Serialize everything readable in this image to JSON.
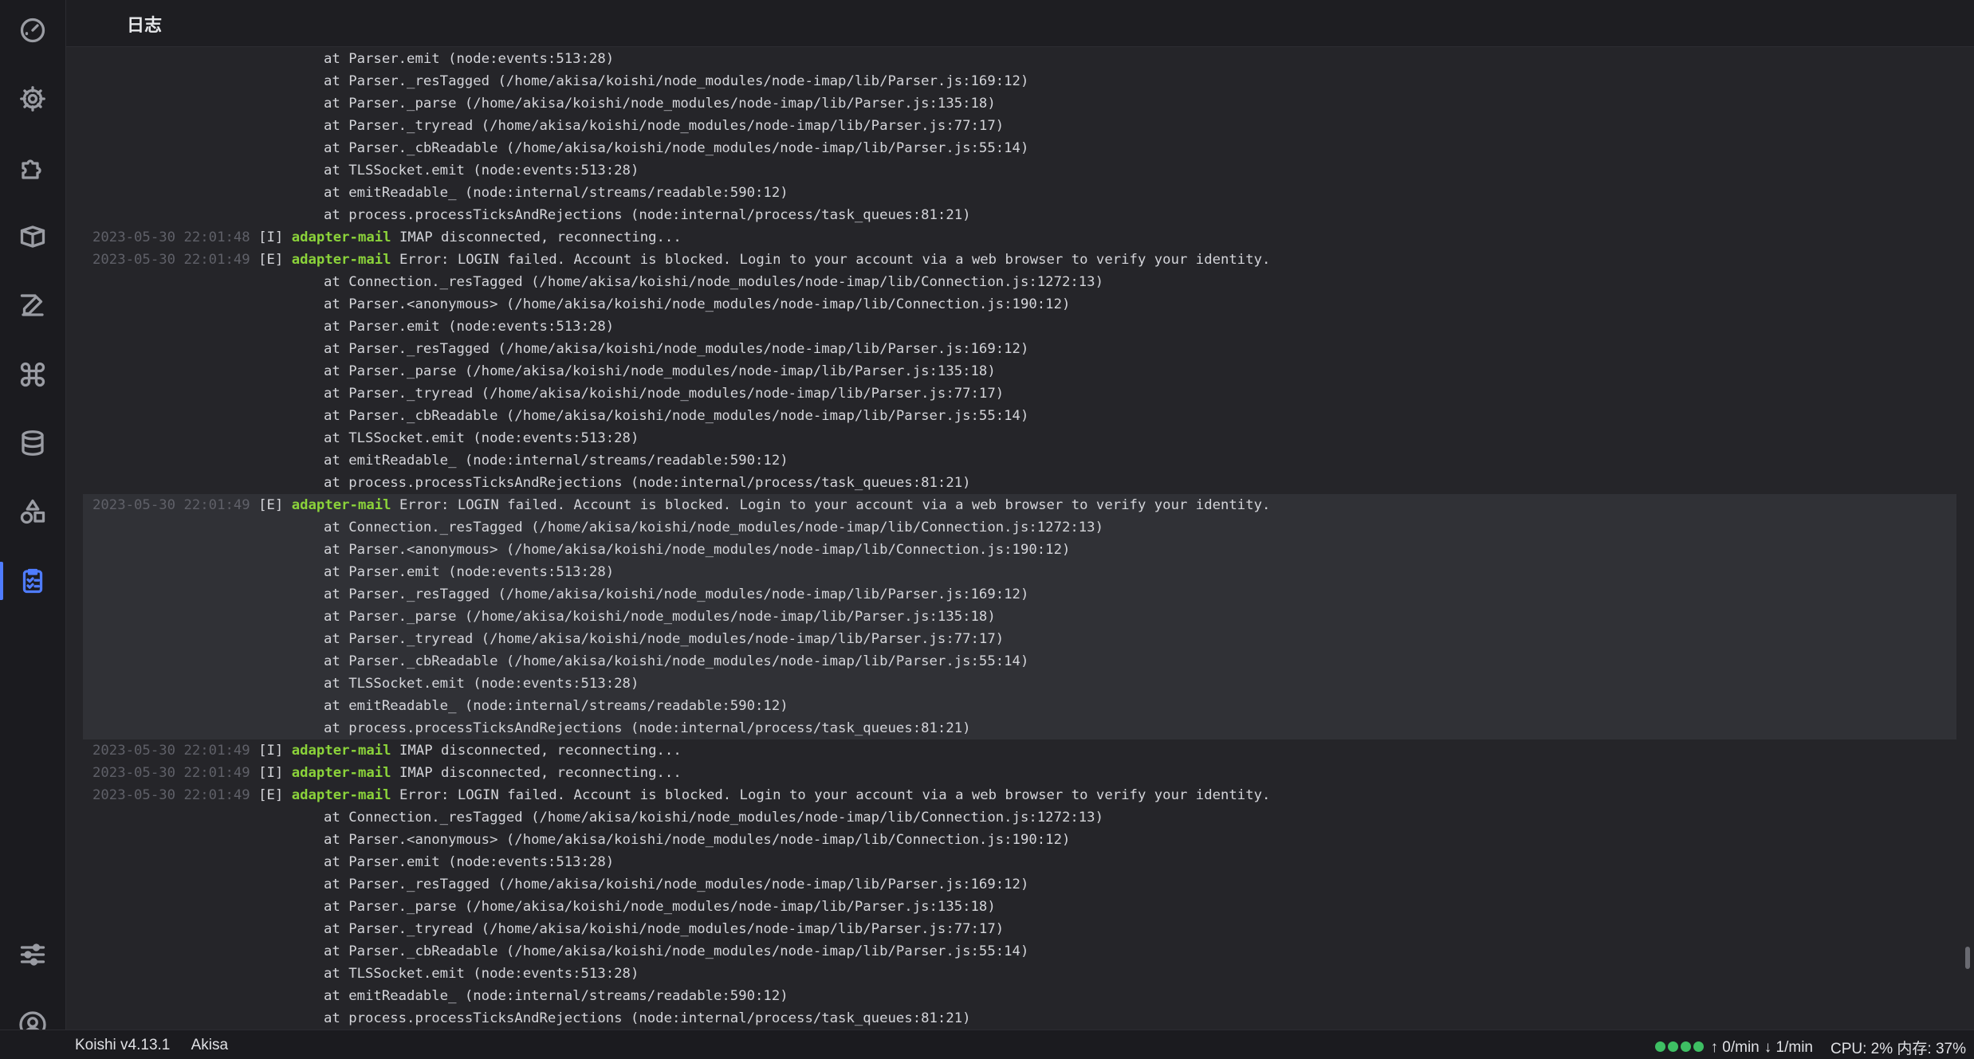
{
  "header": {
    "title": "日志"
  },
  "sidebar": {
    "items": [
      {
        "icon": "dashboard-icon"
      },
      {
        "icon": "settings-icon"
      },
      {
        "icon": "plugins-icon"
      },
      {
        "icon": "market-icon"
      },
      {
        "icon": "edit-icon"
      },
      {
        "icon": "commands-icon"
      },
      {
        "icon": "database-icon"
      },
      {
        "icon": "shapes-icon"
      },
      {
        "icon": "logs-icon"
      },
      {
        "icon": "sliders-icon"
      },
      {
        "icon": "user-icon"
      }
    ],
    "active": "logs-icon",
    "accent": "#4f7cff"
  },
  "log": {
    "lines_top": [
      "at Parser.emit (node:events:513:28)",
      "at Parser._resTagged (/home/akisa/koishi/node_modules/node-imap/lib/Parser.js:169:12)",
      "at Parser._parse (/home/akisa/koishi/node_modules/node-imap/lib/Parser.js:135:18)",
      "at Parser._tryread (/home/akisa/koishi/node_modules/node-imap/lib/Parser.js:77:17)",
      "at Parser._cbReadable (/home/akisa/koishi/node_modules/node-imap/lib/Parser.js:55:14)",
      "at TLSSocket.emit (node:events:513:28)",
      "at emitReadable_ (node:internal/streams/readable:590:12)",
      "at process.processTicksAndRejections (node:internal/process/task_queues:81:21)"
    ],
    "entry1": {
      "ts": "2023-05-30 22:01:48",
      "lvl": "[I]",
      "tag": "adapter-mail",
      "msg": "IMAP disconnected, reconnecting..."
    },
    "entry2": {
      "ts": "2023-05-30 22:01:49",
      "lvl": "[E]",
      "tag": "adapter-mail",
      "msg": "Error: LOGIN failed. Account is blocked. Login to your account via a web browser to verify your identity."
    },
    "stack": [
      "at Connection._resTagged (/home/akisa/koishi/node_modules/node-imap/lib/Connection.js:1272:13)",
      "at Parser.<anonymous> (/home/akisa/koishi/node_modules/node-imap/lib/Connection.js:190:12)",
      "at Parser.emit (node:events:513:28)",
      "at Parser._resTagged (/home/akisa/koishi/node_modules/node-imap/lib/Parser.js:169:12)",
      "at Parser._parse (/home/akisa/koishi/node_modules/node-imap/lib/Parser.js:135:18)",
      "at Parser._tryread (/home/akisa/koishi/node_modules/node-imap/lib/Parser.js:77:17)",
      "at Parser._cbReadable (/home/akisa/koishi/node_modules/node-imap/lib/Parser.js:55:14)",
      "at TLSSocket.emit (node:events:513:28)",
      "at emitReadable_ (node:internal/streams/readable:590:12)",
      "at process.processTicksAndRejections (node:internal/process/task_queues:81:21)"
    ],
    "entry3": {
      "ts": "2023-05-30 22:01:49",
      "lvl": "[E]",
      "tag": "adapter-mail",
      "msg": "Error: LOGIN failed. Account is blocked. Login to your account via a web browser to verify your identity."
    },
    "entry4": {
      "ts": "2023-05-30 22:01:49",
      "lvl": "[I]",
      "tag": "adapter-mail",
      "msg": "IMAP disconnected, reconnecting..."
    },
    "entry5": {
      "ts": "2023-05-30 22:01:49",
      "lvl": "[I]",
      "tag": "adapter-mail",
      "msg": "IMAP disconnected, reconnecting..."
    },
    "entry6": {
      "ts": "2023-05-30 22:01:49",
      "lvl": "[E]",
      "tag": "adapter-mail",
      "msg": "Error: LOGIN failed. Account is blocked. Login to your account via a web browser to verify your identity."
    },
    "colors": {
      "tag": "#8bd33a",
      "timestamp": "#5f6068",
      "highlight": "#303136"
    }
  },
  "status": {
    "version": "Koishi v4.13.1",
    "user": "Akisa",
    "up_rate": "↑ 0/min",
    "down_rate": "↓ 1/min",
    "cpu_mem": "CPU: 2% 内存: 37%",
    "dot_color": "#3ebf63"
  }
}
